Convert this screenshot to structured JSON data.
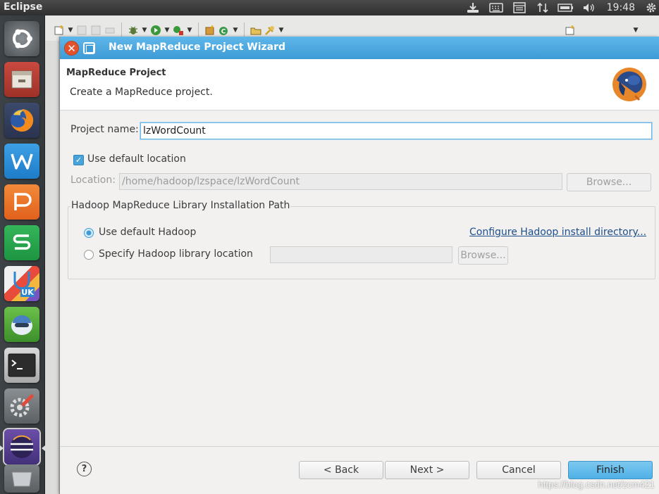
{
  "top_panel": {
    "app_name": "Eclipse",
    "clock": "19:48"
  },
  "dialog": {
    "title": "New MapReduce Project Wizard",
    "header_title": "MapReduce Project",
    "header_description": "Create a MapReduce project.",
    "project_name": {
      "label": "Project name:",
      "value": "lzWordCount"
    },
    "use_default_location": {
      "label": "Use default location",
      "checked": true
    },
    "location": {
      "label": "Location:",
      "value": "/home/hadoop/lzspace/lzWordCount",
      "browse_label": "Browse..."
    },
    "hadoop_group": {
      "legend": "Hadoop MapReduce Library Installation Path",
      "use_default_label": "Use default Hadoop",
      "configure_link": "Configure Hadoop install directory...",
      "specify_label": "Specify Hadoop library location",
      "specify_value": "",
      "browse_label": "Browse...",
      "selected": "use_default"
    },
    "buttons": {
      "back": "< Back",
      "next": "Next >",
      "cancel": "Cancel",
      "finish": "Finish"
    }
  },
  "watermark": "https://blog.csdn.net/zcm421",
  "colors": {
    "titlebar": "#3e9bd6",
    "finish_button": "#4fb1e6",
    "close_button": "#e2532d",
    "link": "#1d4f8a"
  }
}
